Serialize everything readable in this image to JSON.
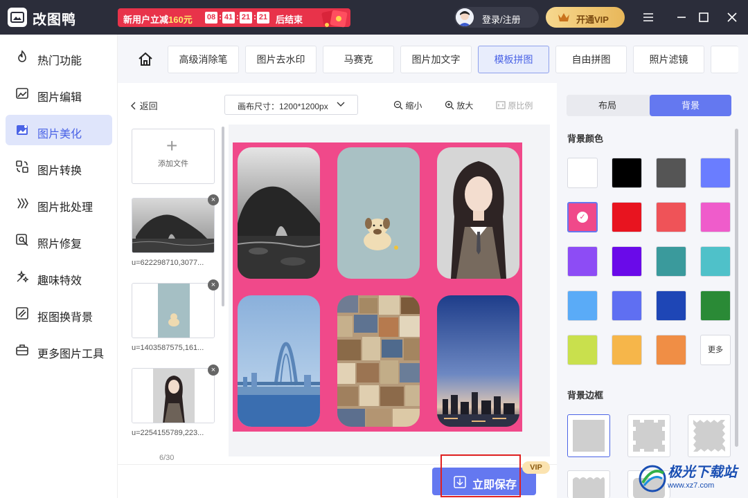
{
  "app": {
    "title": "改图鸭",
    "promo": {
      "text_prefix": "新用户立减",
      "amount": "160元",
      "countdown": [
        "08",
        "41",
        "21",
        "21"
      ],
      "suffix": "后结束"
    },
    "login_label": "登录/注册",
    "vip_label": "开通VIP"
  },
  "sidebar": {
    "items": [
      {
        "label": "热门功能",
        "icon": "flame-icon"
      },
      {
        "label": "图片编辑",
        "icon": "image-edit-icon"
      },
      {
        "label": "图片美化",
        "icon": "image-beautify-icon",
        "active": true
      },
      {
        "label": "图片转换",
        "icon": "convert-icon"
      },
      {
        "label": "图片批处理",
        "icon": "batch-icon"
      },
      {
        "label": "照片修复",
        "icon": "repair-icon"
      },
      {
        "label": "趣味特效",
        "icon": "sparkle-icon"
      },
      {
        "label": "抠图换背景",
        "icon": "cutout-icon"
      },
      {
        "label": "更多图片工具",
        "icon": "toolbox-icon"
      }
    ]
  },
  "tool_tabs": [
    {
      "label": "高级消除笔"
    },
    {
      "label": "图片去水印"
    },
    {
      "label": "马赛克"
    },
    {
      "label": "图片加文字"
    },
    {
      "label": "模板拼图",
      "active": true
    },
    {
      "label": "自由拼图"
    },
    {
      "label": "照片滤镜"
    }
  ],
  "editor": {
    "back_label": "返回",
    "canvas_size_label": "画布尺寸：1200*1200px",
    "zoom_out_label": "缩小",
    "zoom_in_label": "放大",
    "original_label": "原比例",
    "add_file_label": "添加文件",
    "files": [
      {
        "name": "u=622298710,3077..."
      },
      {
        "name": "u=1403587575,161..."
      },
      {
        "name": "u=2254155789,223..."
      }
    ],
    "page_count": "6/30",
    "save_label": "立即保存",
    "vip_tag": "VIP"
  },
  "right_panel": {
    "tabs": [
      {
        "label": "布局"
      },
      {
        "label": "背景",
        "active": true
      }
    ],
    "bg_color_title": "背景颜色",
    "colors": [
      "#ffffff",
      "#000000",
      "#555555",
      "#6a7dff",
      "#f0498a",
      "#e8141f",
      "#ef5358",
      "#ef5ccb",
      "#8d4cf5",
      "#6a0ae9",
      "#3a9a9c",
      "#4fc1c9",
      "#5aabf7",
      "#5f6ff2",
      "#1e46b6",
      "#2a8a36",
      "#c9e04d",
      "#f6b64a",
      "#f08e45"
    ],
    "selected_color": "#f0498a",
    "more_label": "更多",
    "bg_border_title": "背景边框"
  },
  "watermark": {
    "brand": "极光下载站",
    "url": "www.xz7.com"
  }
}
